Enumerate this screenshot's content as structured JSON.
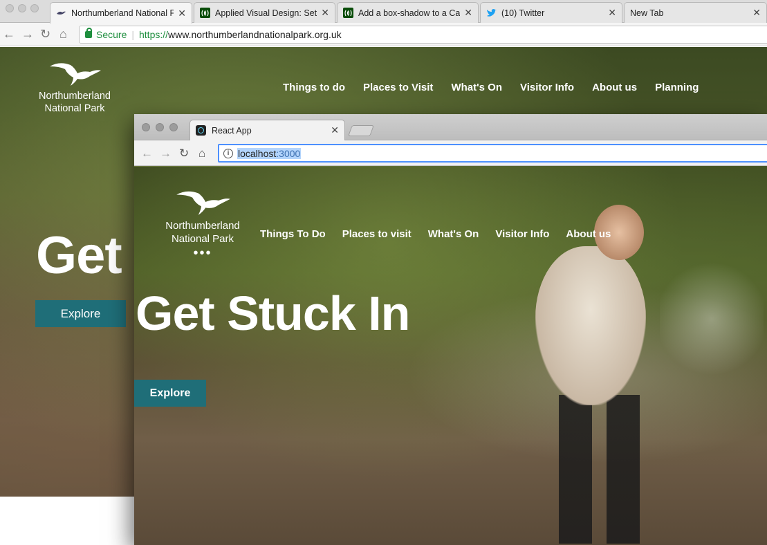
{
  "outer_browser": {
    "tabs": [
      {
        "title": "Northumberland National Pa",
        "active": true,
        "favicon": "heron-favicon"
      },
      {
        "title": "Applied Visual Design: Set",
        "active": false,
        "favicon": "freecodecamp-favicon"
      },
      {
        "title": "Add a box-shadow to a Car",
        "active": false,
        "favicon": "freecodecamp-favicon"
      },
      {
        "title": "(10) Twitter",
        "active": false,
        "favicon": "twitter-bird-favicon"
      },
      {
        "title": "New Tab",
        "active": false,
        "favicon": ""
      }
    ],
    "close_glyph": "✕",
    "secure_label": "Secure",
    "url_protocol": "https://",
    "url_host": "www.northumberlandnationalpark.org.uk"
  },
  "outer_site": {
    "brand_line1": "Northumberland",
    "brand_line2": "National Park",
    "nav": [
      "Things to do",
      "Places to Visit",
      "What's On",
      "Visitor Info",
      "About us",
      "Planning"
    ],
    "hero_partial": "Get",
    "explore_label": "Explore",
    "accent_color": "#1f6e78"
  },
  "inner_browser": {
    "tab_title": "React App",
    "favicon": "react-atom-favicon",
    "close_glyph": "✕",
    "url_host": "localhost",
    "url_port": ":3000"
  },
  "inner_site": {
    "brand_line1": "Northumberland",
    "brand_line2": "National Park",
    "dots": "•••",
    "nav": [
      "Things To Do",
      "Places to visit",
      "What's On",
      "Visitor Info",
      "About us"
    ],
    "hero_title": "Get Stuck In",
    "explore_label": "Explore",
    "accent_color": "#1f6e78"
  }
}
